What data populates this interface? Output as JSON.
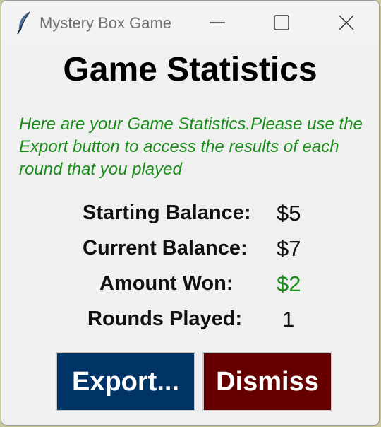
{
  "window": {
    "title": "Mystery Box Game",
    "icon": "feather-icon"
  },
  "heading": "Game Statistics",
  "info_text": "Here are your Game Statistics.Please use the Export button to access the results of each round that you played",
  "stats": [
    {
      "label": "Starting Balance:",
      "value": "$5"
    },
    {
      "label": "Current Balance:",
      "value": "$7"
    },
    {
      "label": "Amount Won:",
      "value": "$2"
    },
    {
      "label": "Rounds Played:",
      "value": "1"
    }
  ],
  "buttons": {
    "export_label": "Export...",
    "dismiss_label": "Dismiss"
  },
  "colors": {
    "export_bg": "#003366",
    "dismiss_bg": "#660000",
    "info_text": "#1a8c1a",
    "amount_won": "#1a8c1a"
  }
}
